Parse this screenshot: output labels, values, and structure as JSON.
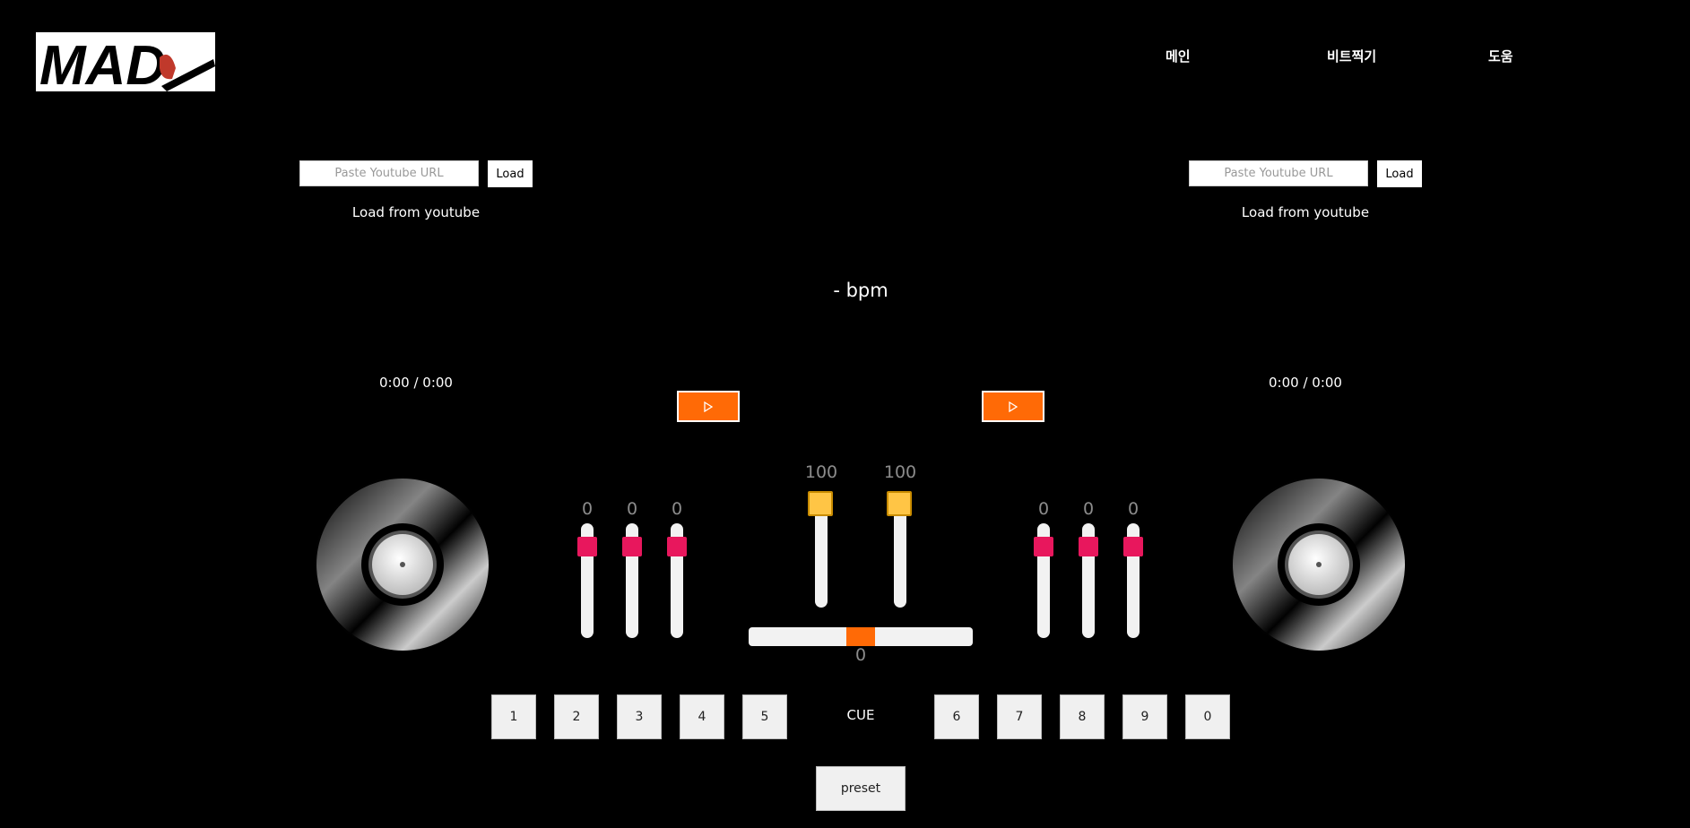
{
  "logo": {
    "text": "MAD"
  },
  "nav": [
    {
      "label": "메인"
    },
    {
      "label": "비트찍기"
    },
    {
      "label": "도움"
    }
  ],
  "decks": [
    {
      "url_placeholder": "Paste Youtube URL",
      "url_value": "",
      "load_label": "Load",
      "load_caption": "Load from youtube",
      "time": "0:00 / 0:00",
      "eq_values": [
        "0",
        "0",
        "0"
      ],
      "play_icon": "play-icon"
    },
    {
      "url_placeholder": "Paste Youtube URL",
      "url_value": "",
      "load_label": "Load",
      "load_caption": "Load from youtube",
      "time": "0:00 / 0:00",
      "eq_values": [
        "0",
        "0",
        "0"
      ],
      "play_icon": "play-icon"
    }
  ],
  "bpm": "- bpm",
  "volume": {
    "left": "100",
    "right": "100"
  },
  "crossfader": {
    "value": "0"
  },
  "cue": {
    "label": "CUE",
    "left_buttons": [
      "1",
      "2",
      "3",
      "4",
      "5"
    ],
    "right_buttons": [
      "6",
      "7",
      "8",
      "9",
      "0"
    ]
  },
  "preset_label": "preset",
  "colors": {
    "background": "#000000",
    "play": "#ff6a06",
    "eq_thumb": "#e8175d",
    "volume_thumb": "#ffc545",
    "crossfader_thumb": "#ff6a06",
    "slider_value": "#8c8c8c"
  }
}
